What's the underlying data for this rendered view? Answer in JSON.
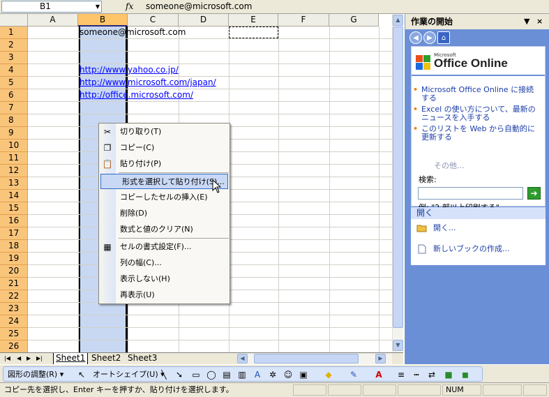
{
  "formula_bar": {
    "name_box": "B1",
    "fx": "fx",
    "value": "someone@microsoft.com"
  },
  "columns": [
    "A",
    "B",
    "C",
    "D",
    "E",
    "F",
    "G"
  ],
  "rows": [
    "1",
    "2",
    "3",
    "4",
    "5",
    "6",
    "7",
    "8",
    "9",
    "10",
    "11",
    "12",
    "13",
    "14",
    "15",
    "16",
    "17",
    "18",
    "19",
    "20",
    "21",
    "22",
    "23",
    "24",
    "25",
    "26"
  ],
  "cells": {
    "b1": "someone@microsoft.com",
    "b4": "http://www.yahoo.co.jp/",
    "b5": "http://www.microsoft.com/japan/",
    "b6": "http://office.microsoft.com/"
  },
  "sheet_tabs": [
    "Sheet1",
    "Sheet2",
    "Sheet3"
  ],
  "context_menu": {
    "items": [
      {
        "label": "切り取り(T)",
        "icon": "scissors-icon"
      },
      {
        "label": "コピー(C)",
        "icon": "copy-icon"
      },
      {
        "label": "貼り付け(P)",
        "icon": "paste-icon"
      },
      {
        "label": "形式を選択して貼り付け(S)...",
        "icon": ""
      },
      {
        "label": "コピーしたセルの挿入(E)",
        "icon": ""
      },
      {
        "label": "削除(D)",
        "icon": ""
      },
      {
        "label": "数式と値のクリア(N)",
        "icon": ""
      },
      {
        "label": "セルの書式設定(F)...",
        "icon": "format-cells-icon"
      },
      {
        "label": "列の幅(C)...",
        "icon": ""
      },
      {
        "label": "表示しない(H)",
        "icon": ""
      },
      {
        "label": "再表示(U)",
        "icon": ""
      }
    ],
    "highlighted": 3
  },
  "task_pane": {
    "title": "作業の開始",
    "logo_small": "Microsoft",
    "logo_text": "Office Online",
    "links": [
      "Microsoft Office Online に接続する",
      "Excel の使い方について、最新のニュースを入手する",
      "このリストを Web から自動的に更新する"
    ],
    "more": "その他...",
    "search_label": "検索:",
    "example": "例: \"2 部以上印刷する\"",
    "open_header": "開く",
    "open_items": [
      "開く...",
      "新しいブックの作成..."
    ]
  },
  "draw_toolbar": {
    "adjust": "図形の調整(R)",
    "autoshape": "オートシェイプ(U)"
  },
  "status_bar": {
    "message": "コピー先を選択し、Enter キーを押すか、貼り付けを選択します。",
    "num": "NUM"
  },
  "colors": {
    "row_header": "#f9c57b",
    "selected_column": "#c8d8f2",
    "pane_blue": "#6b8fd6",
    "link": "#0000ff"
  }
}
